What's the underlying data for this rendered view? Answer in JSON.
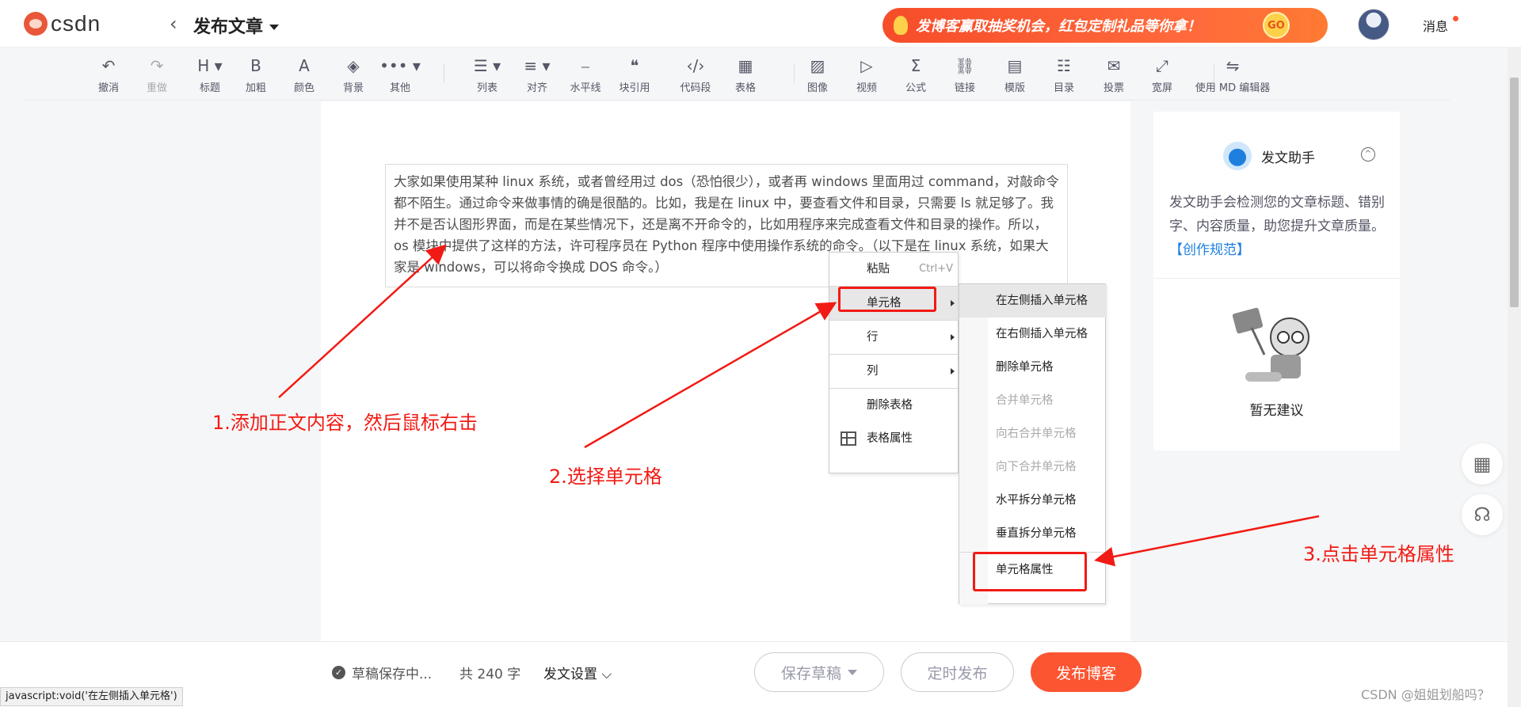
{
  "header": {
    "logo_text": "csdn",
    "page_title": "发布文章",
    "banner_text": "发博客赢取抽奖机会，红包定制礼品等你拿！",
    "banner_go": "GO",
    "messages_label": "消息"
  },
  "toolbar": {
    "items": [
      {
        "label": "撤消",
        "icon": "↶",
        "name": "undo"
      },
      {
        "label": "重做",
        "icon": "↷",
        "name": "redo"
      },
      {
        "label": "标题",
        "icon": "H ▾",
        "name": "heading"
      },
      {
        "label": "加粗",
        "icon": "B",
        "name": "bold"
      },
      {
        "label": "颜色",
        "icon": "A",
        "name": "color"
      },
      {
        "label": "背景",
        "icon": "◈",
        "name": "background"
      },
      {
        "label": "其他",
        "icon": "••• ▾",
        "name": "other"
      },
      {
        "label": "列表",
        "icon": "☰ ▾",
        "name": "list"
      },
      {
        "label": "对齐",
        "icon": "≡ ▾",
        "name": "align"
      },
      {
        "label": "水平线",
        "icon": "⎯",
        "name": "hr"
      },
      {
        "label": "块引用",
        "icon": "❝",
        "name": "quote"
      },
      {
        "label": "代码段",
        "icon": "‹/›",
        "name": "code"
      },
      {
        "label": "表格",
        "icon": "▦",
        "name": "table"
      },
      {
        "label": "图像",
        "icon": "▨",
        "name": "image"
      },
      {
        "label": "视频",
        "icon": "▷",
        "name": "video"
      },
      {
        "label": "公式",
        "icon": "Σ",
        "name": "formula"
      },
      {
        "label": "链接",
        "icon": "⛓",
        "name": "link"
      },
      {
        "label": "模版",
        "icon": "▤",
        "name": "template"
      },
      {
        "label": "目录",
        "icon": "☷",
        "name": "toc"
      },
      {
        "label": "投票",
        "icon": "✉",
        "name": "vote"
      },
      {
        "label": "宽屏",
        "icon": "⤢",
        "name": "widescreen"
      },
      {
        "label": "使用 MD 编辑器",
        "icon": "⇋",
        "name": "md-editor"
      }
    ]
  },
  "editor": {
    "cell_text": "大家如果使用某种 linux 系统，或者曾经用过 dos（恐怕很少），或者再 windows 里面用过 command，对敲命令都不陌生。通过命令来做事情的确是很酷的。比如，我是在 linux 中，要查看文件和目录，只需要 ls 就足够了。我并不是否认图形界面，而是在某些情况下，还是离不开命令的，比如用程序来完成查看文件和目录的操作。所以，os 模块中提供了这样的方法，许可程序员在 Python 程序中使用操作系统的命令。（以下是在 linux 系统，如果大家是 windows，可以将命令换成 DOS 命令。）"
  },
  "context_menu": {
    "paste": "粘贴",
    "paste_shortcut": "Ctrl+V",
    "cell": "单元格",
    "row": "行",
    "column": "列",
    "delete_table": "删除表格",
    "table_props": "表格属性"
  },
  "submenu": {
    "items": [
      {
        "label": "在左侧插入单元格",
        "disabled": false
      },
      {
        "label": "在右侧插入单元格",
        "disabled": false
      },
      {
        "label": "删除单元格",
        "disabled": false
      },
      {
        "label": "合并单元格",
        "disabled": true
      },
      {
        "label": "向右合并单元格",
        "disabled": true
      },
      {
        "label": "向下合并单元格",
        "disabled": true
      },
      {
        "label": "水平拆分单元格",
        "disabled": false
      },
      {
        "label": "垂直拆分单元格",
        "disabled": false
      },
      {
        "label": "单元格属性",
        "disabled": false
      }
    ]
  },
  "side_panel": {
    "title": "发文助手",
    "description": "发文助手会检测您的文章标题、错别字、内容质量，助您提升文章质量。",
    "link": "【创作规范】",
    "empty": "暂无建议"
  },
  "footer": {
    "saving": "草稿保存中...",
    "word_count": "共 240 字",
    "settings": "发文设置",
    "save_draft": "保存草稿",
    "schedule": "定时发布",
    "publish": "发布博客"
  },
  "status_url": "javascript:void('在左侧插入单元格')",
  "watermark": "CSDN @姐姐划船吗？",
  "annotations": {
    "step1": "1.添加正文内容，然后鼠标右击",
    "step2": "2.选择单元格",
    "step3": "3.点击单元格属性"
  },
  "colors": {
    "accent": "#fc5531",
    "annotation": "#f21a14",
    "link": "#1d7fe0"
  }
}
